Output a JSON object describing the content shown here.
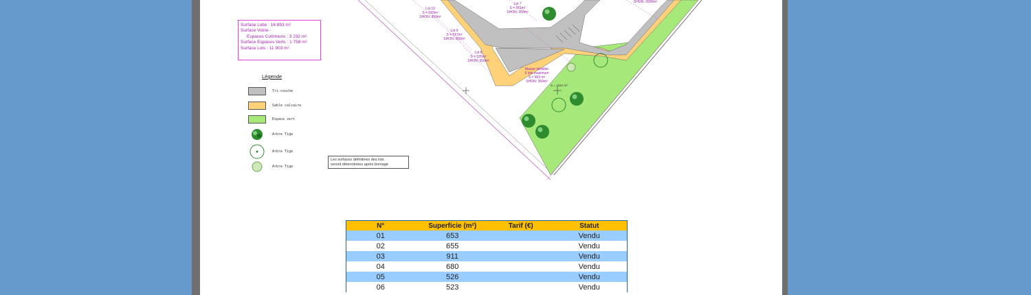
{
  "surfaces": {
    "lotie": "Surface Lotie : 16 893 m²",
    "voirie_1": "Surface Voirie -",
    "voirie_2": "Espaces Communs : 3 232 m²",
    "espaces_verts": "Surface Espaces Verts : 1 758 m²",
    "lots": "Surface Lots : 11 903 m²"
  },
  "legend": {
    "title": "Légende",
    "items": [
      {
        "label": "Tri-couche",
        "color": "#c0c0c0"
      },
      {
        "label": "Sable calcaire",
        "color": "#ffd27a"
      },
      {
        "label": "Espace vert",
        "color": "#a6e87a"
      },
      {
        "label": "Arbre Tige",
        "icon": "tree-icon"
      },
      {
        "label": "Arbre Tige",
        "icon": "tree-circle-icon"
      },
      {
        "label": "Arbre Tige",
        "icon": "shrub-icon"
      }
    ]
  },
  "note": {
    "line1": "Les surfaces définitives des lots",
    "line2": "seront déterminées après bornage"
  },
  "plan": {
    "lot10": {
      "name": "Lot 10",
      "s": "S = 523m²",
      "shon": "SHON: 350m²"
    },
    "lot9": {
      "name": "Lot 9",
      "s": "S = 517m²",
      "shon": "SHON: 350m²"
    },
    "lot8": {
      "name": "Lot 8",
      "s": "S = 526m²",
      "shon": "SHON: 350m²"
    },
    "lot7": {
      "name": "Lot 7",
      "s": "S = 561m²",
      "shon": "SHON: 350m²"
    },
    "masse_1": "Masse divisible",
    "masse_2": "5 lots maximum",
    "masse_3": "S = 963 m²",
    "masse_4": "SHON: 350m²",
    "green_area": "S = 1042 m²",
    "shon_top": "SHON: 2000m²"
  },
  "table": {
    "headers": [
      "N°",
      "Superficie (m²)",
      "Tarif (€)",
      "Statut"
    ],
    "rows": [
      [
        "01",
        "653",
        "",
        "Vendu"
      ],
      [
        "02",
        "655",
        "",
        "Vendu"
      ],
      [
        "03",
        "911",
        "",
        "Vendu"
      ],
      [
        "04",
        "680",
        "",
        "Vendu"
      ],
      [
        "05",
        "526",
        "",
        "Vendu"
      ],
      [
        "06",
        "523",
        "",
        "Vendu"
      ]
    ]
  }
}
